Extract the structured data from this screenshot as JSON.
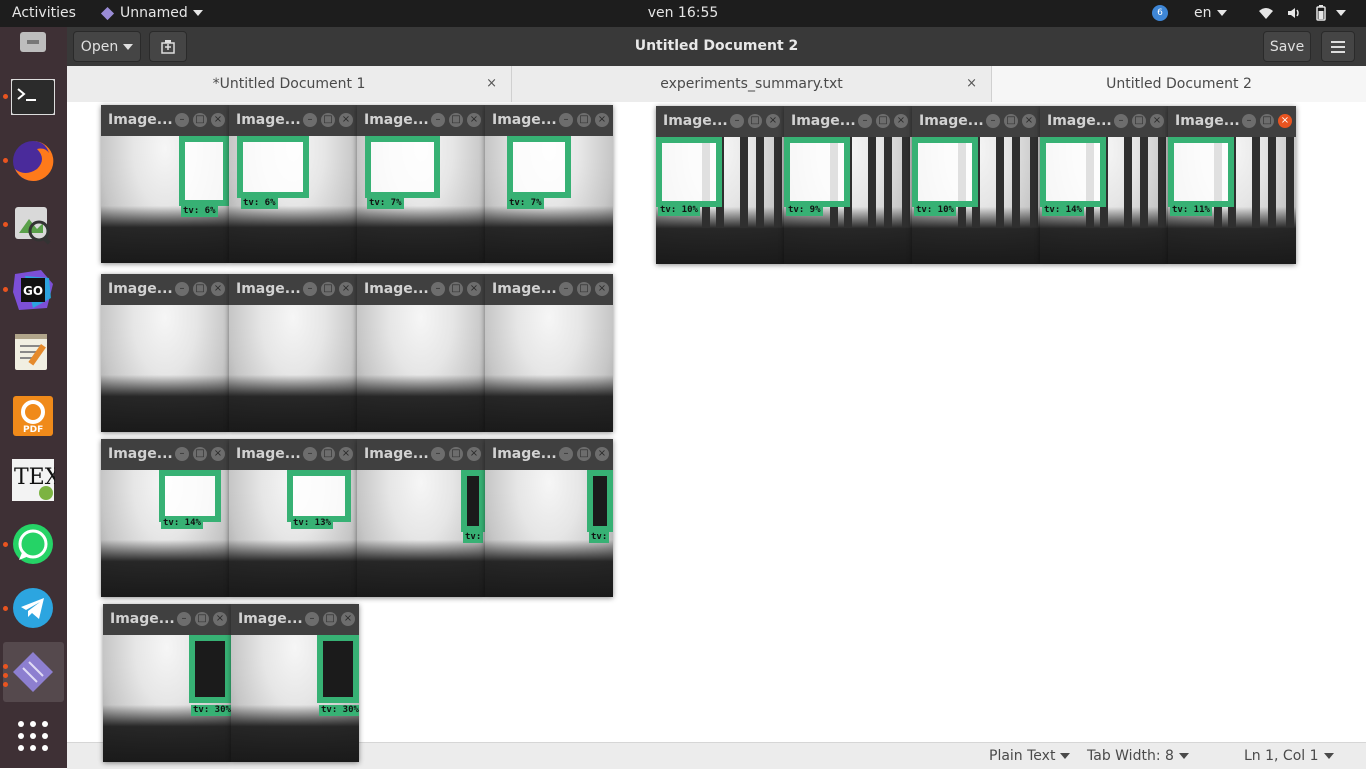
{
  "topbar": {
    "activities": "Activities",
    "app_name": "Unnamed",
    "clock": "ven 16:55",
    "notif_count": "6",
    "lang": "en"
  },
  "dock": {
    "items": [
      "terminal",
      "firefox",
      "image-viewer",
      "goland",
      "text-editor",
      "foxit-pdf",
      "texmaker",
      "whatsapp",
      "telegram",
      "unnamed-app",
      "show-applications"
    ]
  },
  "header": {
    "open_label": "Open",
    "title": "Untitled Document 2",
    "save_label": "Save"
  },
  "tabs": [
    {
      "label": "*Untitled Document 1",
      "close": "×"
    },
    {
      "label": "experiments_summary.txt",
      "close": "×"
    },
    {
      "label": "Untitled Document 2"
    }
  ],
  "status": {
    "lang": "Plain Text",
    "tab_width": "Tab Width: 8",
    "position": "Ln 1, Col 1"
  },
  "image_windows": [
    {
      "title": "Image...",
      "label": "tv: 6%"
    },
    {
      "title": "Image...",
      "label": "tv: 6%"
    },
    {
      "title": "Image...",
      "label": "tv: 7%"
    },
    {
      "title": "Image...",
      "label": "tv: 7%"
    },
    {
      "title": "Image..."
    },
    {
      "title": "Image..."
    },
    {
      "title": "Image..."
    },
    {
      "title": "Image..."
    },
    {
      "title": "Image...",
      "label": "tv: 14%"
    },
    {
      "title": "Image...",
      "label": "tv: 13%"
    },
    {
      "title": "Image...",
      "label": "tv:"
    },
    {
      "title": "Image...",
      "label": "tv:"
    },
    {
      "title": "Image...",
      "label": "tv: 30%"
    },
    {
      "title": "Image...",
      "label": "tv: 30%"
    },
    {
      "title": "Image...",
      "label": "tv: 10%"
    },
    {
      "title": "Image...",
      "label": "tv: 9%"
    },
    {
      "title": "Image...",
      "label": "tv: 10%"
    },
    {
      "title": "Image...",
      "label": "tv: 14%"
    },
    {
      "title": "Image...",
      "label": "tv: 11%"
    }
  ],
  "colors": {
    "detection_box": "#37b174",
    "accent": "#e95420"
  }
}
